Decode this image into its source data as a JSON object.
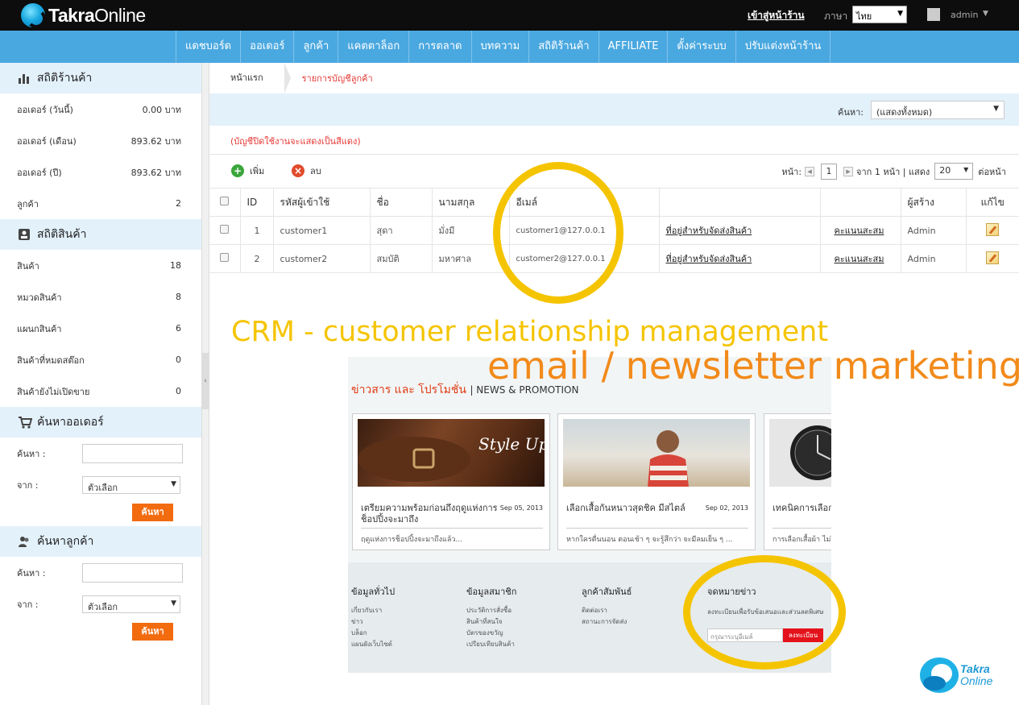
{
  "brand": {
    "name_bold": "Takra",
    "name_light": "Online"
  },
  "topbar": {
    "store_link": "เข้าสู่หน้าร้าน",
    "language_label": "ภาษา",
    "language_value": "ไทย",
    "user_name": "admin"
  },
  "nav": {
    "items": [
      "แดชบอร์ด",
      "ออเดอร์",
      "ลูกค้า",
      "แคตตาล็อก",
      "การตลาด",
      "บทความ",
      "สถิติร้านค้า",
      "AFFILIATE",
      "ตั้งค่าระบบ",
      "ปรับแต่งหน้าร้าน"
    ]
  },
  "sidebar": {
    "store_stats": {
      "title": "สถิติร้านค้า",
      "rows": [
        {
          "label": "ออเดอร์ (วันนี้)",
          "value": "0.00 บาท"
        },
        {
          "label": "ออเดอร์ (เดือน)",
          "value": "893.62 บาท"
        },
        {
          "label": "ออเดอร์ (ปี)",
          "value": "893.62 บาท"
        },
        {
          "label": "ลูกค้า",
          "value": "2"
        }
      ]
    },
    "product_stats": {
      "title": "สถิติสินค้า",
      "rows": [
        {
          "label": "สินค้า",
          "value": "18"
        },
        {
          "label": "หมวดสินค้า",
          "value": "8"
        },
        {
          "label": "แผนกสินค้า",
          "value": "6"
        },
        {
          "label": "สินค้าที่หมดสต๊อก",
          "value": "0"
        },
        {
          "label": "สินค้ายังไม่เปิดขาย",
          "value": "0"
        }
      ]
    },
    "order_search": {
      "title": "ค้นหาออเดอร์",
      "search_label": "ค้นหา :",
      "from_label": "จาก :",
      "from_value": "ตัวเลือก",
      "button": "ค้นหา"
    },
    "customer_search": {
      "title": "ค้นหาลูกค้า",
      "search_label": "ค้นหา :",
      "from_label": "จาก :",
      "from_value": "ตัวเลือก",
      "button": "ค้นหา"
    }
  },
  "breadcrumb": {
    "home": "หน้าแรก",
    "current": "รายการบัญชีลูกค้า"
  },
  "filter": {
    "label": "ค้นหา:",
    "value": "(แสดงทั้งหมด)"
  },
  "note": "(บัญชีปิดใช้งานจะแสดงเป็นสีแดง)",
  "toolbar": {
    "add": "เพิ่ม",
    "delete": "ลบ"
  },
  "pager": {
    "page_label": "หน้า:",
    "page_value": "1",
    "of_text": "จาก 1 หน้า | แสดง",
    "per_page": "20",
    "per_page_suffix": "ต่อหน้า"
  },
  "table": {
    "headers": {
      "id": "ID",
      "username": "รหัสผู้เข้าใช้",
      "first": "ชื่อ",
      "last": "นามสกุล",
      "email": "อีเมล์",
      "creator": "ผู้สร้าง",
      "edit": "แก้ไข"
    },
    "rows": [
      {
        "id": "1",
        "username": "customer1",
        "first": "สุดา",
        "last": "มั่งมี",
        "email": "customer1@127.0.0.1",
        "address": "ที่อยู่สำหรับจัดส่งสินค้า",
        "points": "คะแนนสะสม",
        "creator": "Admin"
      },
      {
        "id": "2",
        "username": "customer2",
        "first": "สมบัติ",
        "last": "มหาศาล",
        "email": "customer2@127.0.0.1",
        "address": "ที่อยู่สำหรับจัดส่งสินค้า",
        "points": "คะแนนสะสม",
        "creator": "Admin"
      }
    ]
  },
  "overlay": {
    "crm": "CRM - customer relationship management",
    "email": "email / newsletter marketing"
  },
  "newsletter": {
    "title": "ข่าวสาร และ โปรโมชั่น",
    "title_en": "| NEWS & PROMOTION",
    "cards": [
      {
        "title": "เตรียมความพร้อมก่อนถึงฤดูแห่งการช็อปปิ้งจะมาถึง",
        "date": "Sep 05, 2013",
        "sub": "ฤดูแห่งการช็อปปิ้งจะมาถึงแล้ว...",
        "img_text": "Style Updates"
      },
      {
        "title": "เลือกเสื้อกันหนาวสุดชิค มีสไตล์",
        "date": "Sep 02, 2013",
        "sub": "หากใครตื่นนอน ตอนเช้า ๆ จะรู้สึกว่า จะมีลมเย็น ๆ ..."
      },
      {
        "title": "เทคนิคการเลือกเสื้อ",
        "date": "",
        "sub": "การเลือกเสื้อผ้า ไม่ใช่"
      }
    ],
    "footer": {
      "col1": {
        "title": "ข้อมูลทั่วไป",
        "items": [
          "เกี่ยวกับเรา",
          "ข่าว",
          "บล็อก",
          "แผนผังเว็บไซต์"
        ]
      },
      "col2": {
        "title": "ข้อมูลสมาชิก",
        "items": [
          "ประวัติการสั่งซื้อ",
          "สินค้าที่สนใจ",
          "บัตรของขวัญ",
          "เปรียบเทียบสินค้า"
        ]
      },
      "col3": {
        "title": "ลูกค้าสัมพันธ์",
        "items": [
          "ติดต่อเรา",
          "สถานะการจัดส่ง"
        ]
      },
      "col4": {
        "title": "จดหมายข่าว",
        "desc": "ลงทะเบียนเพื่อรับข้อเสนอและส่วนลดพิเศษ",
        "placeholder": "กรุณาระบุอีเมล์",
        "button": "ลงทะเบียน"
      }
    }
  },
  "bottom_brand": {
    "line1": "Takra",
    "line2": "Online"
  },
  "colors": {
    "nav": "#4aa8e0",
    "accent_orange": "#f26b0f",
    "highlight_yellow": "#f5c400",
    "overlay_orange": "#f28a1a",
    "error_red": "#e53935"
  }
}
